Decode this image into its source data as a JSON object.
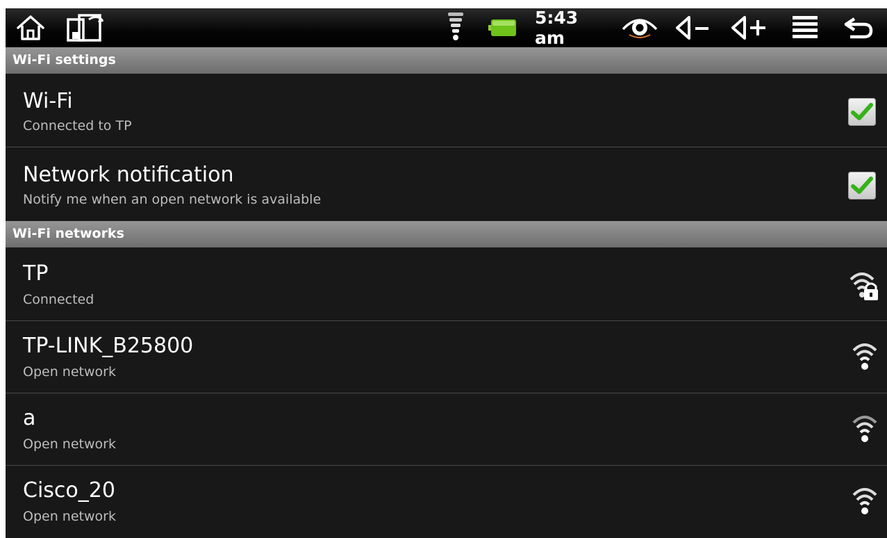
{
  "statusbar": {
    "time": "5:43 am",
    "icons": [
      "home-icon",
      "recent-apps-icon",
      "wifi-signal-icon",
      "battery-icon",
      "eye-icon",
      "volume-down-icon",
      "volume-up-icon",
      "menu-icon",
      "back-icon"
    ],
    "battery_color": "#7ecb1e"
  },
  "sections": {
    "wifi_settings": "Wi-Fi settings",
    "wifi_networks": "Wi-Fi networks"
  },
  "settings": [
    {
      "title": "Wi-Fi",
      "summary": "Connected to TP",
      "checked": true
    },
    {
      "title": "Network notification",
      "summary": "Notify me when an open network is available",
      "checked": true
    }
  ],
  "networks": [
    {
      "ssid": "TP",
      "status": "Connected",
      "secured": true,
      "icon": "wifi-locked-icon"
    },
    {
      "ssid": "TP-LINK_B25800",
      "status": "Open network",
      "secured": false,
      "icon": "wifi-icon"
    },
    {
      "ssid": "a",
      "status": "Open network",
      "secured": false,
      "icon": "wifi-icon"
    },
    {
      "ssid": "Cisco_20",
      "status": "Open network",
      "secured": false,
      "icon": "wifi-icon"
    }
  ],
  "colors": {
    "background": "#181818",
    "check_green": "#35b21a",
    "section_gray": "#7e7e7e"
  }
}
